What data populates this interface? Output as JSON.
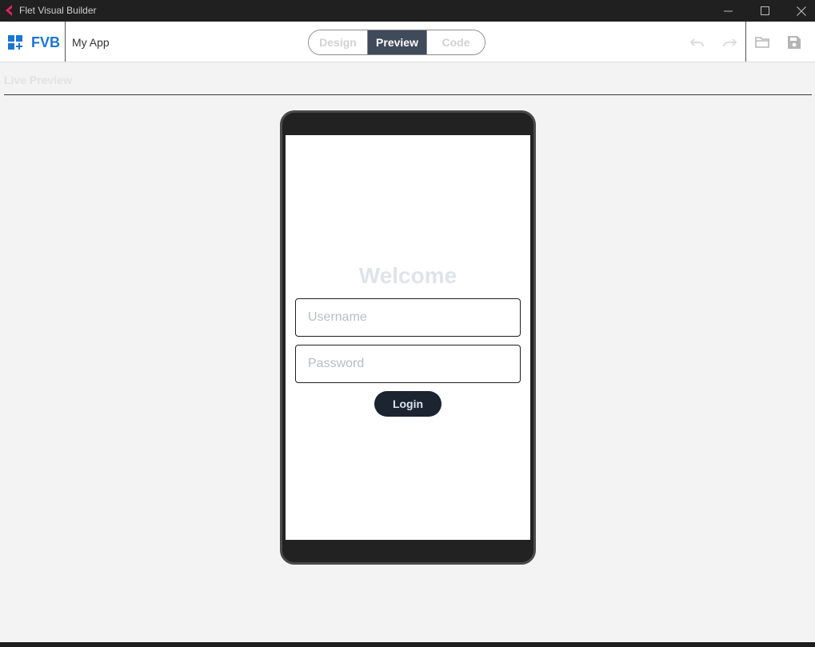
{
  "window": {
    "title": "Flet Visual Builder",
    "icons": [
      "flet-app-icon",
      "minimize-icon",
      "maximize-icon",
      "close-icon"
    ]
  },
  "appbar": {
    "logo_text": "FVB",
    "app_name": "My App",
    "modes": [
      {
        "label": "Design",
        "active": false
      },
      {
        "label": "Preview",
        "active": true
      },
      {
        "label": "Code",
        "active": false
      }
    ],
    "tools": [
      "undo-icon",
      "redo-icon",
      "folder-icon",
      "save-icon"
    ]
  },
  "preview": {
    "section_title": "Live Preview",
    "screen": {
      "heading": "Welcome",
      "username_placeholder": "Username",
      "password_placeholder": "Password",
      "login_label": "Login"
    }
  },
  "colors": {
    "brand": "#1976d2",
    "titlebar": "#202020",
    "segment_active": "#3f4a5a",
    "login_button": "#1c2430",
    "app_icon": "#e91e63"
  }
}
